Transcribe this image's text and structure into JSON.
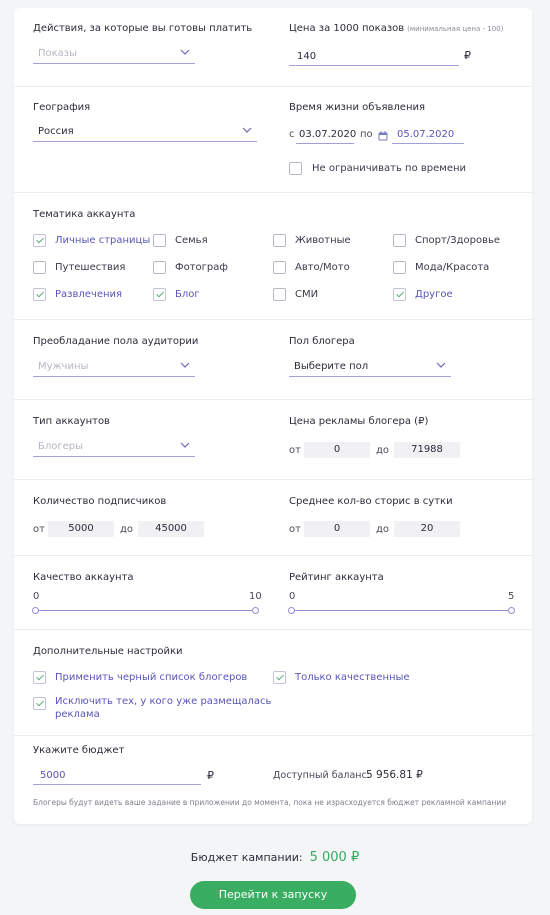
{
  "actions": {
    "label": "Действия, за которые вы готовы платить",
    "value": "Показы"
  },
  "price": {
    "label": "Цена за 1000 показов",
    "hint": "(минимальная цена - 100)",
    "value": "140",
    "currency": "₽"
  },
  "geo": {
    "label": "География",
    "value": "Россия"
  },
  "lifetime": {
    "label": "Время жизни объявления",
    "from_label": "с",
    "from": "03.07.2020",
    "to_label": "по",
    "to": "05.07.2020",
    "unlimited": "Не ограничивать по времени",
    "unlimited_checked": false
  },
  "topics": {
    "label": "Тематика аккаунта",
    "items": [
      {
        "label": "Личные страницы",
        "checked": true
      },
      {
        "label": "Семья",
        "checked": false
      },
      {
        "label": "Животные",
        "checked": false
      },
      {
        "label": "Спорт/Здоровье",
        "checked": false
      },
      {
        "label": "Путешествия",
        "checked": false
      },
      {
        "label": "Фотограф",
        "checked": false
      },
      {
        "label": "Авто/Мото",
        "checked": false
      },
      {
        "label": "Мода/Красота",
        "checked": false
      },
      {
        "label": "Развлечения",
        "checked": true
      },
      {
        "label": "Блог",
        "checked": true
      },
      {
        "label": "СМИ",
        "checked": false
      },
      {
        "label": "Другое",
        "checked": true
      }
    ]
  },
  "audience_gender": {
    "label": "Преобладание пола аудитории",
    "value": "Мужчины"
  },
  "blogger_gender": {
    "label": "Пол блогера",
    "value": "Выберите пол"
  },
  "account_type": {
    "label": "Тип аккаунтов",
    "value": "Блогеры"
  },
  "ad_price": {
    "label": "Цена рекламы блогера (₽)",
    "from_label": "от",
    "from": "0",
    "to_label": "до",
    "to": "71988"
  },
  "followers": {
    "label": "Количество подписчиков",
    "from_label": "от",
    "from": "5000",
    "to_label": "до",
    "to": "45000"
  },
  "stories": {
    "label": "Среднее кол-во сторис в сутки",
    "from_label": "от",
    "from": "0",
    "to_label": "до",
    "to": "20"
  },
  "quality": {
    "label": "Качество аккаунта",
    "min": "0",
    "max": "10"
  },
  "rating": {
    "label": "Рейтинг аккаунта",
    "min": "0",
    "max": "5"
  },
  "extra": {
    "label": "Дополнительные настройки",
    "blacklist": "Применить черный список блогеров",
    "quality_only": "Только качественные",
    "exclude_line1": "Исключить тех, у кого уже размещалась",
    "exclude_line2": "реклама"
  },
  "budget": {
    "label": "Укажите бюджет",
    "value": "5000",
    "currency": "₽",
    "balance_label": "Доступный баланс:",
    "balance": "5 956.81 ₽",
    "note": "Блогеры будут видеть ваше задание в приложении до момента, пока не израсходуется бюджет рекламной кампании"
  },
  "campaign": {
    "label": "Бюджет кампании:",
    "amount": "5 000 ₽"
  },
  "launch_label": "Перейти к запуску",
  "colors": {
    "accent": "#39ad62",
    "link": "#5a55b8",
    "underline": "#9fa0d8"
  }
}
